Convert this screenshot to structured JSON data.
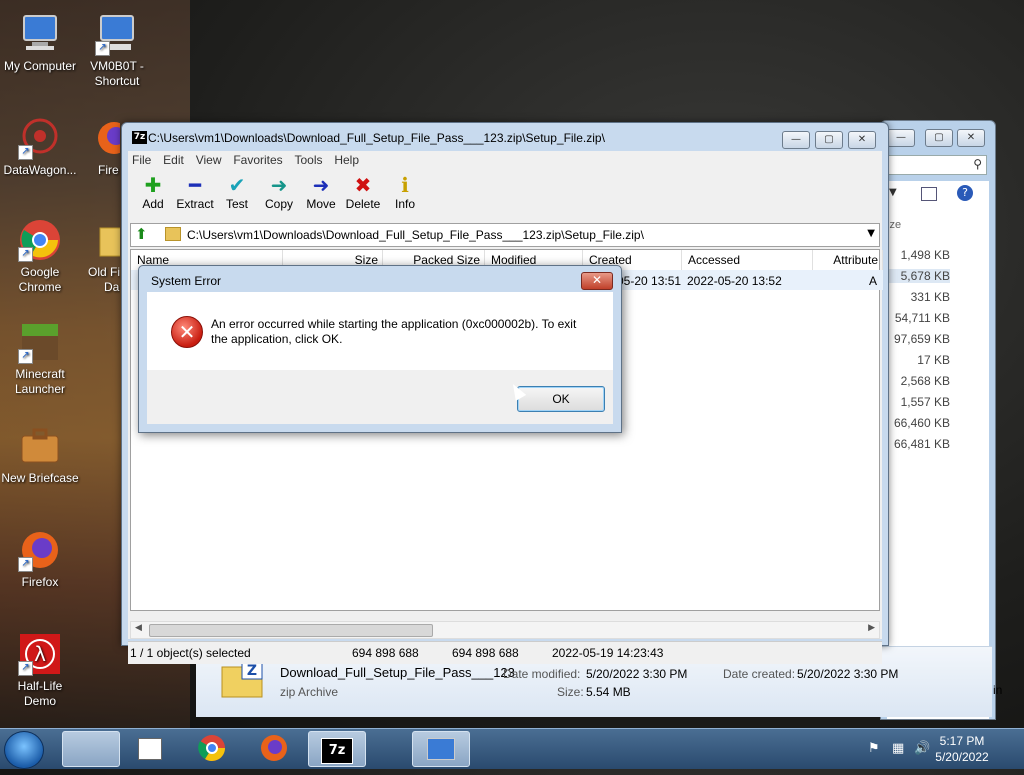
{
  "desktop": {
    "icons": [
      {
        "label_l1": "My Computer",
        "label_l2": ""
      },
      {
        "label_l1": "VM0B0T -",
        "label_l2": "Shortcut"
      },
      {
        "label_l1": "DataWagon...",
        "label_l2": ""
      },
      {
        "label_l1": "Fire",
        "label_l2": ""
      },
      {
        "label_l1": "Google",
        "label_l2": "Chrome"
      },
      {
        "label_l1": "Old Fi",
        "label_l2": "Da"
      },
      {
        "label_l1": "Minecraft",
        "label_l2": "Launcher"
      },
      {
        "label_l1": "New Briefcase",
        "label_l2": ""
      },
      {
        "label_l1": "Firefox",
        "label_l2": ""
      },
      {
        "label_l1": "Half-Life",
        "label_l2": "Demo"
      }
    ]
  },
  "bg_explorer": {
    "size_header": "ize",
    "sizes": [
      "1,498 KB",
      "5,678 KB",
      "331 KB",
      "54,711 KB",
      "97,659 KB",
      "17 KB",
      "2,568 KB",
      "1,557 KB",
      "66,460 KB",
      "66,481 KB"
    ],
    "details": {
      "file_name": "Download_Full_Setup_File_Pass___123",
      "file_type": "zip Archive",
      "date_modified_label": "Date modified:",
      "date_modified": "5/20/2022 3:30 PM",
      "date_created_label": "Date created:",
      "date_created": "5/20/2022 3:30 PM",
      "size_label": "Size:",
      "size": "5.54 MB",
      "cut_text": "in"
    }
  },
  "sevenzip": {
    "title": "C:\\Users\\vm1\\Downloads\\Download_Full_Setup_File_Pass___123.zip\\Setup_File.zip\\",
    "app_icon": "7z",
    "menu": [
      "File",
      "Edit",
      "View",
      "Favorites",
      "Tools",
      "Help"
    ],
    "toolbar": [
      {
        "label": "Add",
        "icon": "plus-icon",
        "glyph": "✚",
        "color": "#1ea01e"
      },
      {
        "label": "Extract",
        "icon": "minus-icon",
        "glyph": "━",
        "color": "#1c2fb8"
      },
      {
        "label": "Test",
        "icon": "check-icon",
        "glyph": "✔",
        "color": "#1aa3b8"
      },
      {
        "label": "Copy",
        "icon": "arrow-right-icon",
        "glyph": "➜",
        "color": "#15958a"
      },
      {
        "label": "Move",
        "icon": "arrow-right-icon",
        "glyph": "➜",
        "color": "#1c2fb8"
      },
      {
        "label": "Delete",
        "icon": "x-icon",
        "glyph": "✖",
        "color": "#d01010"
      },
      {
        "label": "Info",
        "icon": "info-icon",
        "glyph": "ℹ",
        "color": "#c8a000"
      }
    ],
    "address": "C:\\Users\\vm1\\Downloads\\Download_Full_Setup_File_Pass___123.zip\\Setup_File.zip\\",
    "columns": [
      "Name",
      "Size",
      "Packed Size",
      "Modified",
      "Created",
      "Accessed",
      "Attribute"
    ],
    "row": {
      "created": "-05-20 13:51",
      "accessed": "2022-05-20 13:52",
      "attr": "A"
    },
    "status": {
      "selected": "1 / 1 object(s) selected",
      "size": "694 898 688",
      "packed": "694 898 688",
      "modified": "2022-05-19 14:23:43"
    }
  },
  "dialog": {
    "title": "System Error",
    "message": "An error occurred while starting the application (0xc000002b). To exit the application, click OK.",
    "ok": "OK",
    "close": "✕"
  },
  "taskbar": {
    "clock_time": "5:17 PM",
    "clock_date": "5/20/2022"
  }
}
